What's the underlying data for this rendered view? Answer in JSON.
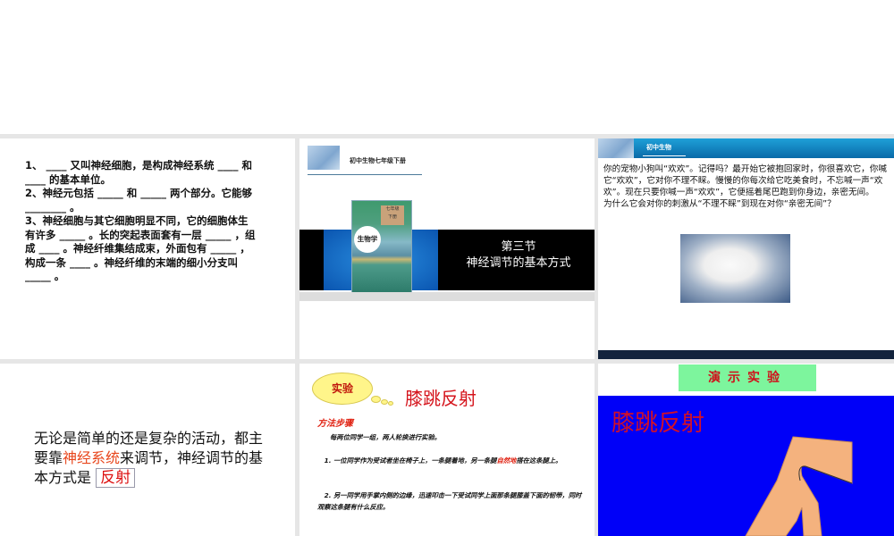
{
  "slides": {
    "s1": {
      "lines": [
        "1、 ____ 又叫神经细胞，是构成神经系统 ____ 和 ____ 的基本单位。",
        "2、神经元包括 _____ 和 _____ 两个部分。它能够 ________ 。",
        "3、神经细胞与其它细胞明显不同，它的细胞体生有许多 _____ 。长的突起表面套有一层 _____ ，组成 ____ 。神经纤维集结成束，外面包有 _____ ，构成一条 ____ 。神经纤维的末端的细小分支叫 _____ 。"
      ]
    },
    "s2": {
      "header": "初中生物七年级下册",
      "book_grade": "七年级",
      "book_volume": "下册",
      "book_title": "生物学",
      "section": "第三节",
      "title": "神经调节的基本方式"
    },
    "s3": {
      "header": "初中生物",
      "paragraph": "你的宠物小狗叫“欢欢”。记得吗？最开始它被抱回家时，你很喜欢它，你喊它“欢欢”，它对你不理不睬。慢慢的你每次给它吃美食时，不忘喊一声“欢欢”。现在只要你喊一声“欢欢”，它便摇着尾巴跑到你身边，亲密无间。",
      "question": "为什么它会对你的刺激从“不理不睬”到现在对你“亲密无间”？"
    },
    "s4": {
      "part1": "无论是简单的还是复杂的活动，都主要靠",
      "highlight": "神经系统",
      "part2": "来调节，神经调节的基本方式是",
      "answer": "反射"
    },
    "s5": {
      "cloud": "实验",
      "title": "膝跳反射",
      "method_heading": "方法步骤",
      "intro": "每两位同学一组，两人轮换进行实验。",
      "step1_a": "1. 一位同学作为受试者坐在椅子上，一条腿着地，另一条腿",
      "step1_highlight": "自然地",
      "step1_b": "搭在这条腿上。",
      "step2": "2. 另一同学用手掌内侧的边缘，迅速叩击一下受试同学上面那条腿膝盖下面的韧带，同时观察这条腿有什么反应。"
    },
    "s6": {
      "banner": "演示实验",
      "title": "膝跳反射"
    }
  },
  "colors": {
    "accent_red": "#d5141c",
    "highlight_orange": "#e8461c",
    "demo_blue": "#0000f8",
    "banner_green": "#7df59d"
  }
}
